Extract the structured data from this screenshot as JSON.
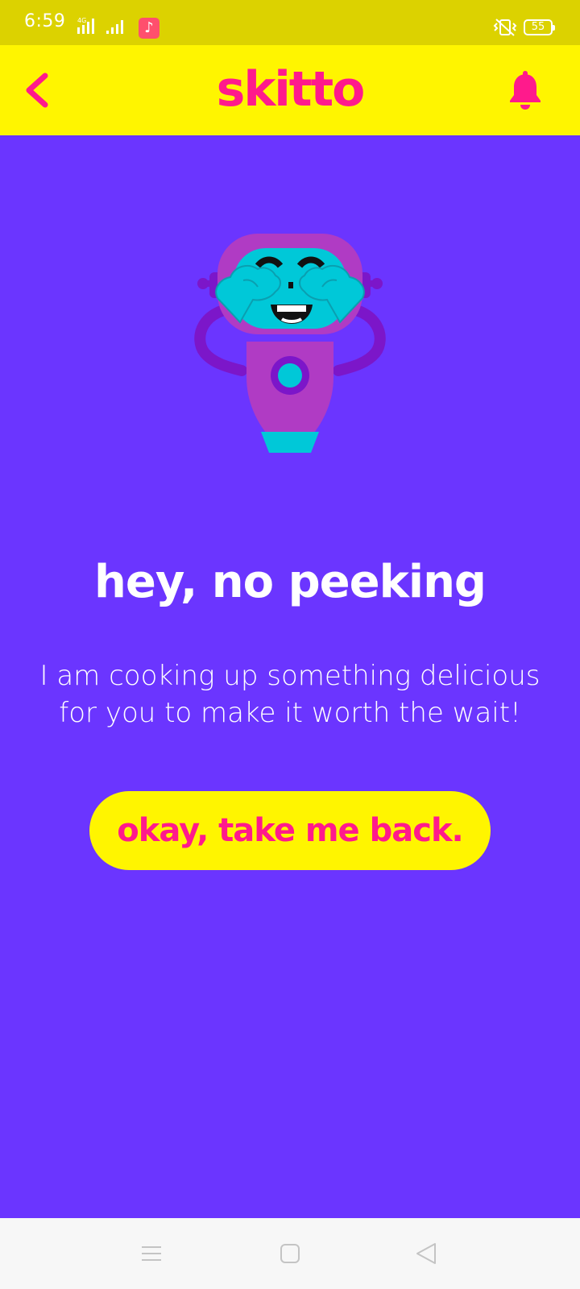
{
  "status_bar": {
    "time": "6:59",
    "network": "4G",
    "battery": "55",
    "icons": [
      "signal-icon",
      "music-app-icon",
      "vibrate-icon",
      "battery-icon"
    ]
  },
  "header": {
    "logo": "skitto",
    "back_icon": "chevron-left-icon",
    "notification_icon": "bell-icon"
  },
  "main": {
    "illustration": "robot-covering-eyes",
    "headline": "hey, no peeking",
    "subtext": "I am cooking up something delicious for you to make it worth the wait!",
    "cta_label": "okay, take me back."
  },
  "nav_bar": {
    "icons": [
      "menu-icon",
      "home-icon",
      "back-icon"
    ]
  },
  "colors": {
    "background": "#6b35ff",
    "header_bg": "#fff500",
    "status_bg": "#dcd200",
    "accent_pink": "#ff1a8c",
    "robot_purple": "#b03bc4",
    "robot_cyan": "#00c8d8"
  }
}
